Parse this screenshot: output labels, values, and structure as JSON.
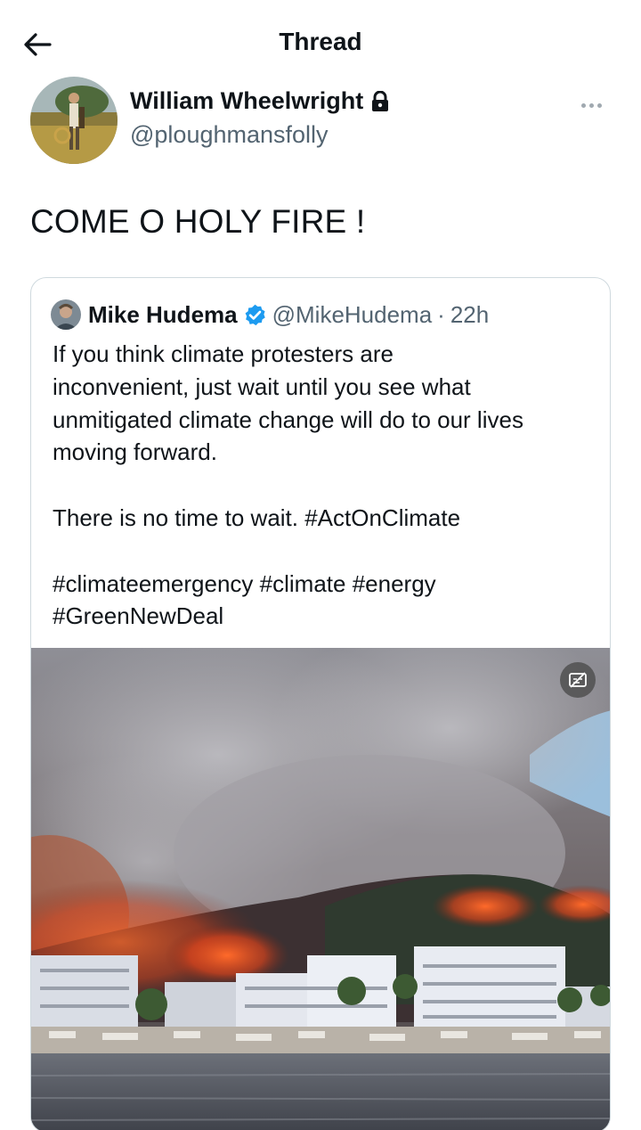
{
  "header": {
    "title": "Thread",
    "back_icon": "arrow-left-icon"
  },
  "tweet": {
    "author_name": "William Wheelwright",
    "author_handle": "@ploughmansfolly",
    "protected_icon": "lock-icon",
    "more_icon": "more-horizontal-icon",
    "text": "COME O HOLY FIRE !"
  },
  "quoted_tweet": {
    "author_name": "Mike Hudema",
    "verified_icon": "verified-badge-icon",
    "author_handle": "@MikeHudema",
    "separator": "·",
    "time": "22h",
    "text": "If you think climate protesters are\ninconvenient, just wait until you see what\nunmitigated climate change will do to our lives\nmoving forward.\n\nThere is no time to wait. #ActOnClimate\n\n#climateemergency #climate #energy\n#GreenNewDeal",
    "media_icon": "subtitles-off-icon"
  },
  "colors": {
    "text": "#0f1419",
    "secondary": "#536471",
    "verified": "#1d9bf0",
    "border": "#cfd9de"
  }
}
